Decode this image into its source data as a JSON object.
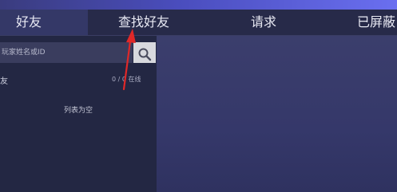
{
  "tabs": [
    {
      "label": "好友",
      "active": true
    },
    {
      "label": "查找好友",
      "active": false
    },
    {
      "label": "请求",
      "active": false
    },
    {
      "label": "已屏蔽",
      "active": false
    }
  ],
  "search": {
    "placeholder": "玩家姓名或ID"
  },
  "friends": {
    "label": "友",
    "count": "0 / 0 在线"
  },
  "empty_text": "列表为空",
  "colors": {
    "annotation_arrow": "#e02828",
    "tab_active_bg": "#343867"
  }
}
